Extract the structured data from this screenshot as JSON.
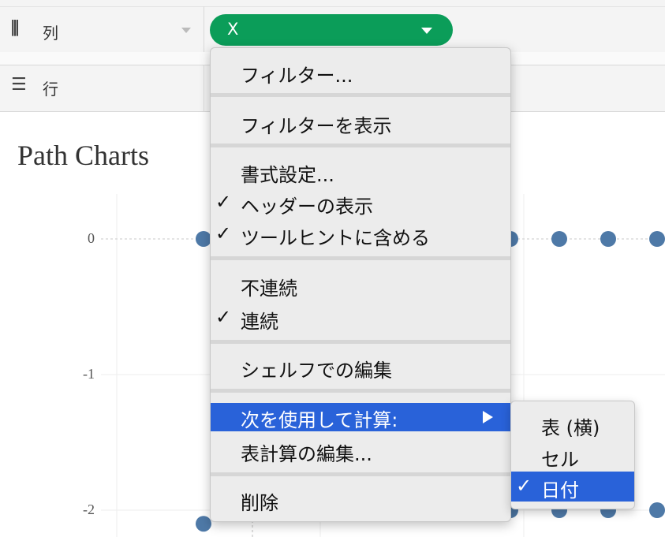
{
  "shelves": {
    "columns": {
      "icon": "columns-icon",
      "label": "列",
      "pill": "X"
    },
    "rows": {
      "icon": "rows-icon",
      "label": "行"
    }
  },
  "viz": {
    "title": "Path Charts"
  },
  "chart_data": {
    "type": "scatter",
    "title": "Path Charts",
    "y_ticks": [
      "0",
      "-1",
      "-2"
    ],
    "ylim": [
      -2.1,
      0.3
    ],
    "xlim": [
      0,
      12
    ],
    "grid": true,
    "series": [
      {
        "x": [
          1,
          2,
          7,
          8,
          9,
          10
        ],
        "y": [
          0,
          0,
          0,
          0,
          0,
          0
        ]
      },
      {
        "x": [
          1,
          1.5,
          7,
          8,
          9,
          10
        ],
        "y": [
          -2.1,
          -2.02,
          -2,
          -2,
          -2,
          -2
        ]
      }
    ],
    "marker_color": "#4e79a7"
  },
  "context_menu": {
    "items": {
      "filter": "フィルター...",
      "show_filter": "フィルターを表示",
      "format": "書式設定...",
      "show_header": "ヘッダーの表示",
      "include_tooltip": "ツールヒントに含める",
      "discrete": "不連続",
      "continuous": "連続",
      "edit_in_shelf": "シェルフでの編集",
      "compute_using": "次を使用して計算:",
      "edit_table_calc": "表計算の編集...",
      "remove": "削除"
    },
    "check_glyph": "✓"
  },
  "submenu": {
    "table_across": "表 (横)",
    "cell": "セル",
    "date": "日付"
  },
  "colors": {
    "pill": "#0b9d59",
    "highlight": "#2962d9",
    "mark": "#4e79a7"
  }
}
